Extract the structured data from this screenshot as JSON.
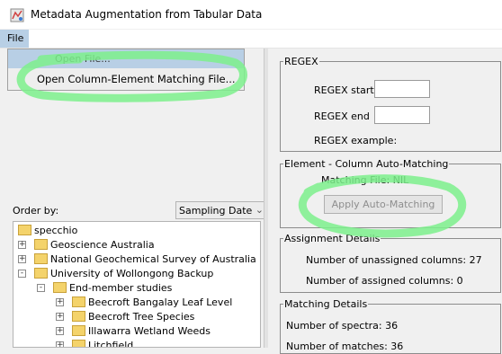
{
  "window": {
    "title": "Metadata Augmentation from Tabular Data"
  },
  "menubar": {
    "file": "File"
  },
  "file_menu": {
    "items": [
      "Open File...",
      "Open Column-Element Matching File..."
    ]
  },
  "left": {
    "order_by_label": "Order by:",
    "sort_value": "Sampling Date",
    "tree": [
      {
        "label": "specchio",
        "expander": ""
      },
      {
        "label": "Geoscience Australia",
        "expander": "+"
      },
      {
        "label": "National Geochemical Survey of Australia",
        "expander": "+"
      },
      {
        "label": "University of Wollongong Backup",
        "expander": "-"
      },
      {
        "label": "End-member studies",
        "expander": "-"
      },
      {
        "label": "Beecroft Bangalay Leaf Level",
        "expander": "+"
      },
      {
        "label": "Beecroft Tree Species",
        "expander": "+"
      },
      {
        "label": "Illawarra Wetland Weeds",
        "expander": "+"
      },
      {
        "label": "Litchfield",
        "expander": "+"
      }
    ]
  },
  "regex": {
    "legend": "REGEX",
    "start_label": "REGEX start",
    "end_label": "REGEX end",
    "example_label": "REGEX example:",
    "start_value": "",
    "end_value": ""
  },
  "automatch": {
    "legend": "Element - Column Auto-Matching",
    "matching_file": "Matching File: NIL",
    "apply_button": "Apply Auto-Matching"
  },
  "assignment": {
    "legend": "Assignment Details",
    "unassigned": "Number of unassigned columns: 27",
    "assigned": "Number of assigned columns: 0"
  },
  "matching": {
    "legend": "Matching Details",
    "spectra": "Number of spectra: 36",
    "matches": "Number of matches: 36"
  },
  "colors": {
    "highlight": "#b8cfe5",
    "annotation": "#7cf08c",
    "folder": "#f4d36b"
  }
}
